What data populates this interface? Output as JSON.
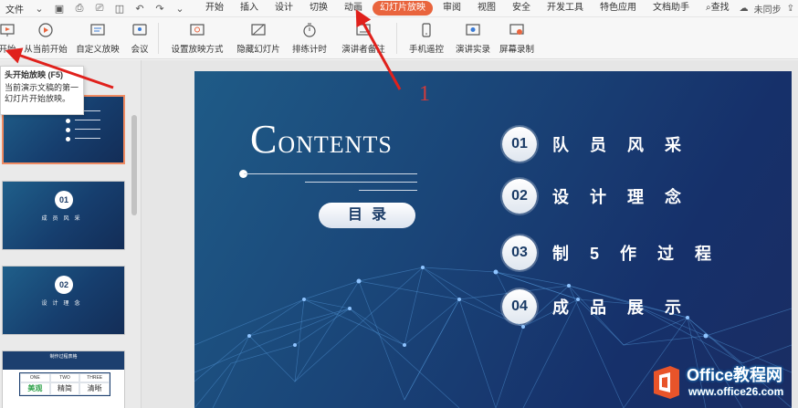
{
  "menubar": {
    "file_label": "文件",
    "tabs": [
      "开始",
      "插入",
      "设计",
      "切换",
      "动画",
      "幻灯片放映",
      "审阅",
      "视图",
      "安全",
      "开发工具",
      "特色应用",
      "文档助手"
    ],
    "active_tab": "幻灯片放映",
    "search_label": "查找",
    "sync_label": "未同步"
  },
  "ribbon": {
    "buttons": [
      {
        "label": "开始",
        "icon": "slideshow-start-icon"
      },
      {
        "label": "从当前开始",
        "icon": "play-circle-icon"
      },
      {
        "label": "自定义放映",
        "icon": "custom-show-icon"
      },
      {
        "label": "会议",
        "icon": "meeting-icon"
      },
      {
        "label": "设置放映方式",
        "icon": "setup-show-icon"
      },
      {
        "label": "隐藏幻灯片",
        "icon": "hide-slide-icon"
      },
      {
        "label": "排练计时",
        "icon": "timer-icon"
      },
      {
        "label": "演讲者备注",
        "icon": "speaker-notes-icon"
      },
      {
        "label": "手机遥控",
        "icon": "phone-remote-icon"
      },
      {
        "label": "演讲实录",
        "icon": "record-icon"
      },
      {
        "label": "屏幕录制",
        "icon": "screen-record-icon"
      }
    ]
  },
  "tooltip": {
    "title": "头开始放映 (F5)",
    "body": "当前演示文稿的第一幻灯片开始放映。"
  },
  "thumbnails": [
    {
      "type": "contents"
    },
    {
      "type": "section",
      "number": "01",
      "caption": "成员风采"
    },
    {
      "type": "section",
      "number": "02",
      "caption": "设计理念"
    },
    {
      "type": "table",
      "header": "制作过程表格",
      "cols": [
        "ONE",
        "TWO",
        "THREE"
      ],
      "cells": [
        "美观",
        "精简",
        "清晰"
      ]
    }
  ],
  "slide": {
    "title_initial": "C",
    "title_rest": "ONTENTS",
    "subtitle": "目录",
    "items": [
      {
        "number": "01",
        "label": "队员风采"
      },
      {
        "number": "02",
        "label": "设计理念"
      },
      {
        "number": "03",
        "label": "制5作过程"
      },
      {
        "number": "04",
        "label": "成品展示"
      }
    ]
  },
  "annotation": {
    "marker": "1",
    "color": "#d23b3b"
  },
  "watermark": {
    "line1": "Office教程网",
    "line2": "www.office26.com"
  },
  "colors": {
    "accent_tab": "#e9643d",
    "slide_bg": "#1a4578",
    "arrow": "#e0211c"
  }
}
